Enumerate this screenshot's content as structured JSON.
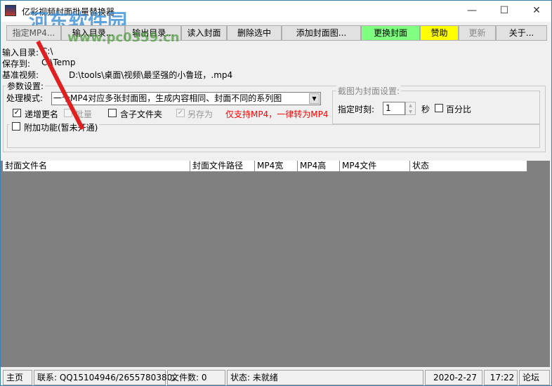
{
  "window": {
    "title": "亿彩视频封面批量替换器",
    "minimize": "—",
    "maximize": "☐",
    "close": "✕"
  },
  "watermark": {
    "text": "河东软件园",
    "url": "www.pc0359.cn"
  },
  "toolbar": [
    {
      "label": "指定MP4...",
      "state": "normal"
    },
    {
      "label": "输入目录...",
      "state": "normal"
    },
    {
      "label": "输出目录...",
      "state": "normal"
    },
    {
      "label": "读入封面",
      "state": "normal"
    },
    {
      "label": "删除选中",
      "state": "normal"
    },
    {
      "label": "添加封面图...",
      "state": "normal"
    },
    {
      "label": "更换封面",
      "color": "#80ff80"
    },
    {
      "label": "赞助",
      "color": "#ffff00"
    },
    {
      "label": "更新",
      "state": "disabled"
    },
    {
      "label": "关于...",
      "state": "normal"
    }
  ],
  "info": {
    "input_dir_label": "输入目录:",
    "input_dir": "C:\\",
    "save_label": "保存到:",
    "save": "C:\\Temp",
    "base_label": "基准视频:",
    "base": "D:\\tools\\桌面\\视频\\最坚强的小鲁班，.mp4"
  },
  "params": {
    "legend": "参数设置:",
    "mode_label": "处理模式:",
    "mode_value": "一个MP4对应多张封面图，生成内容相同、封面不同的系列图",
    "increment_rename": {
      "label": "递增更名",
      "checked": true
    },
    "batch": {
      "label": "批量",
      "checked": false,
      "disabled": true
    },
    "subfolder": {
      "label": "含子文件夹",
      "checked": false
    },
    "save_as": {
      "label": "另存为",
      "checked": true,
      "disabled": true
    },
    "note": "仅支持MP4，一律转为MP4",
    "note_color": "#ff0000",
    "capture": {
      "legend": "截图为封面设置:",
      "time_label": "指定时刻:",
      "time_value": "1",
      "unit": "秒",
      "percent_label": "百分比",
      "percent_checked": false
    },
    "extra": {
      "label": "附加功能(暂未开通)",
      "checked": false
    }
  },
  "table": {
    "columns": [
      "封面文件名",
      "封面文件路径",
      "MP4宽",
      "MP4高",
      "MP4文件",
      "状态"
    ],
    "rows": []
  },
  "statusbar": {
    "home": "主页",
    "contact": "联系: QQ15104946/2655780380。",
    "file_count": "文件数: 0",
    "status": "状态: 未就绪",
    "date": "2020-2-27",
    "time": "17:22",
    "forum": "论坛"
  }
}
